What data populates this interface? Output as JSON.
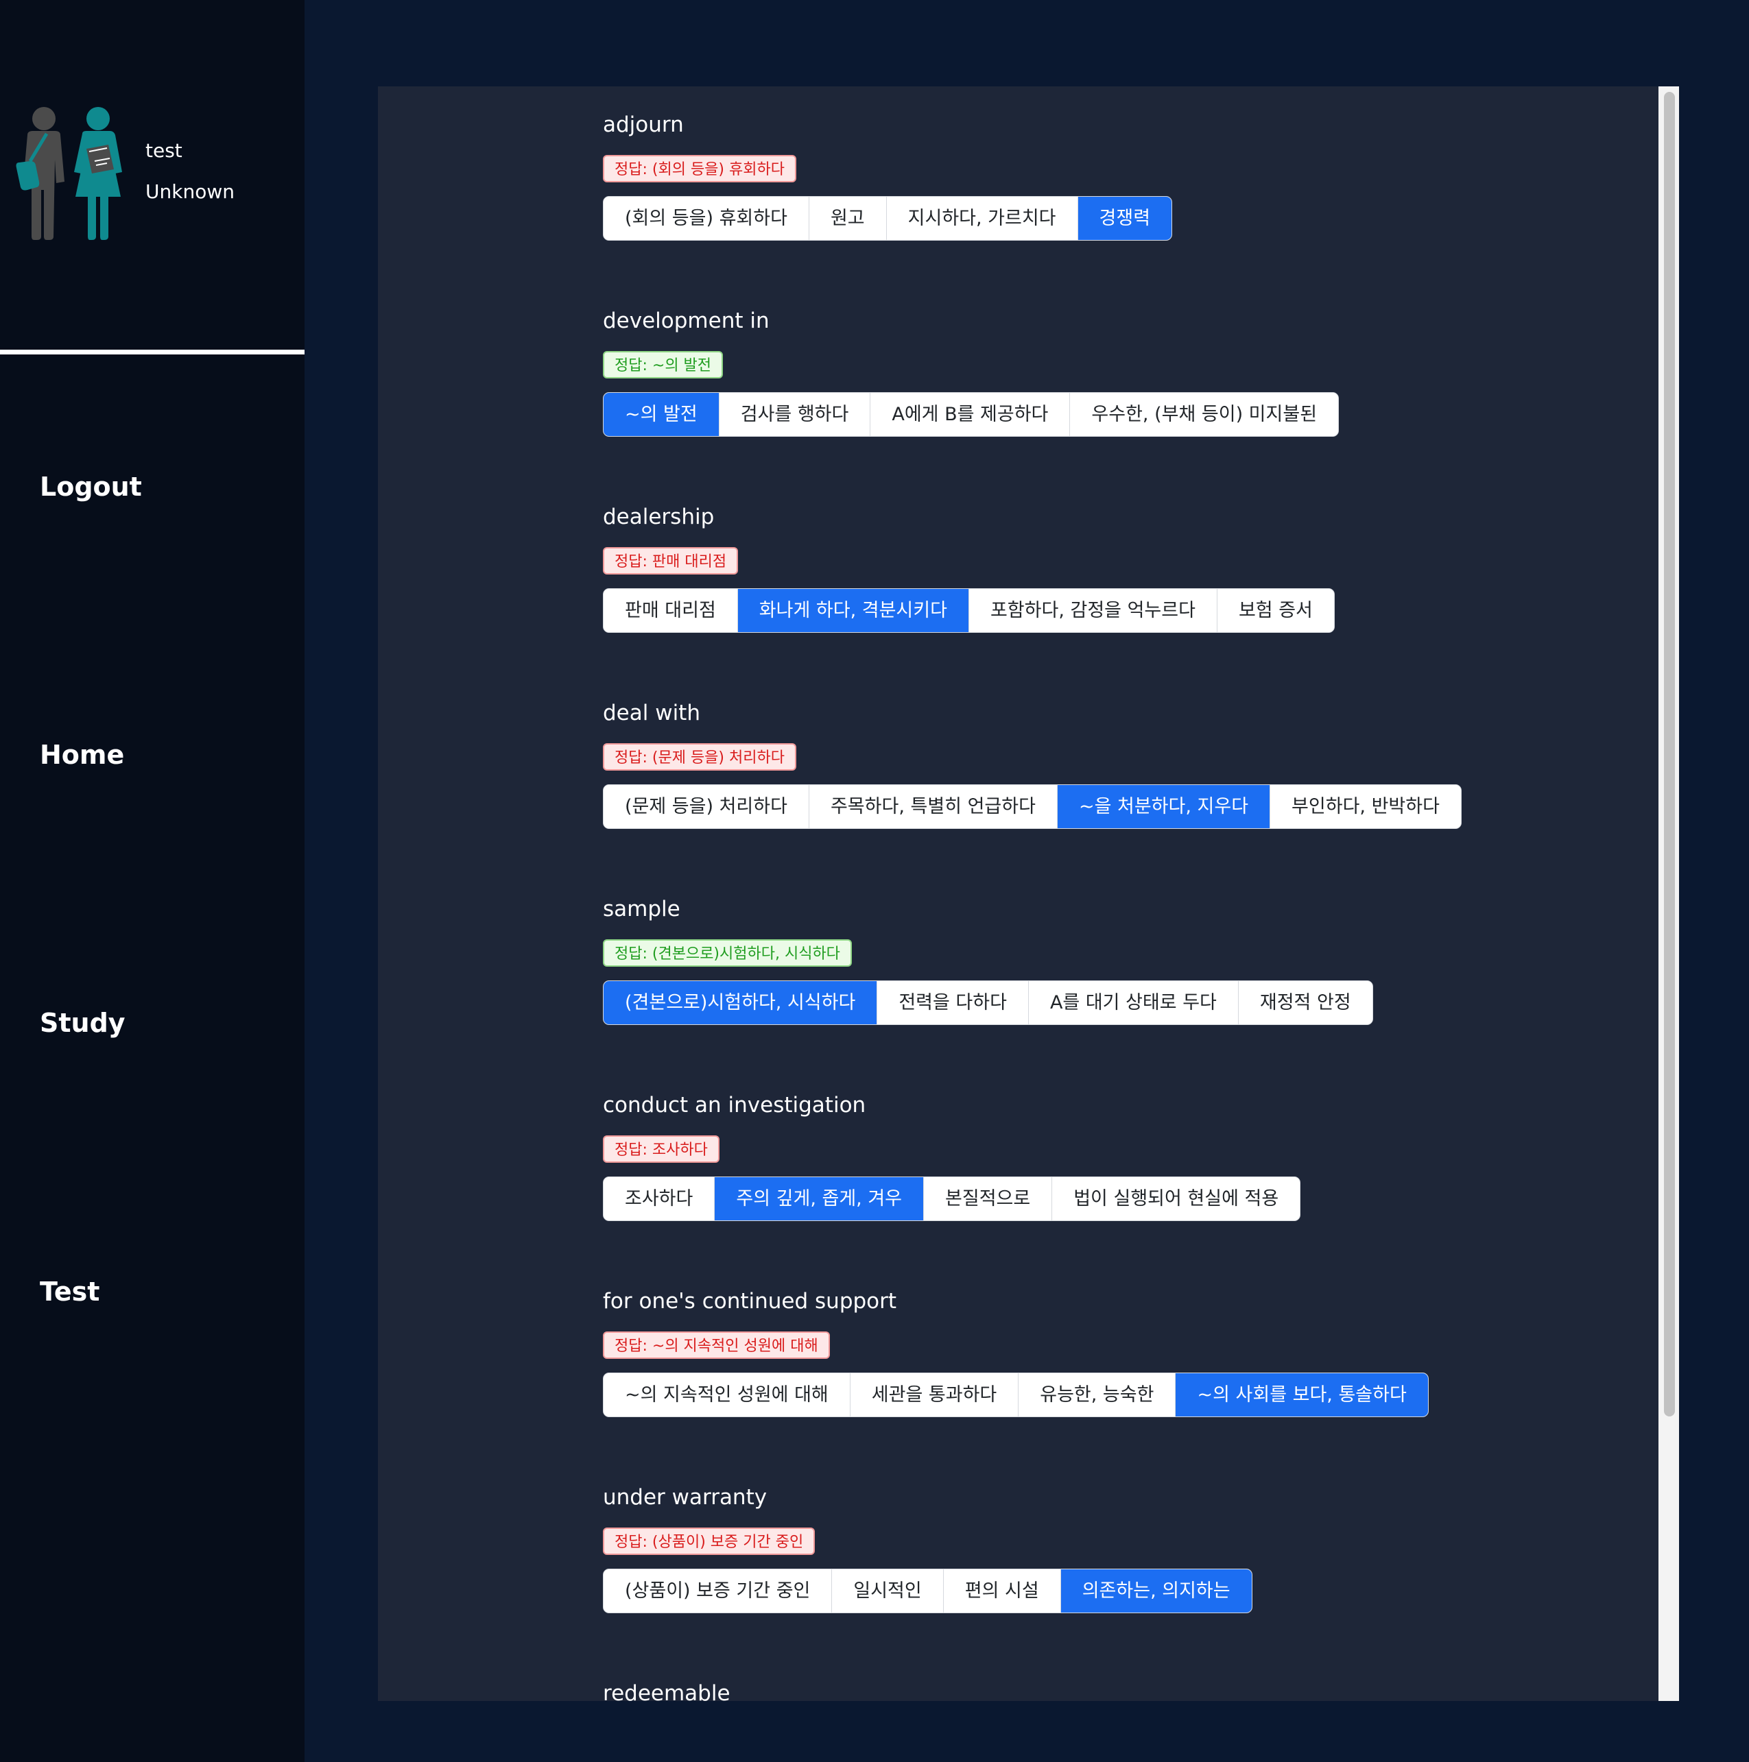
{
  "user": {
    "name": "test",
    "status": "Unknown"
  },
  "nav": {
    "logout": "Logout",
    "home": "Home",
    "study": "Study",
    "test": "Test"
  },
  "questions": [
    {
      "word": "adjourn",
      "answer": "정답: (회의 등을) 휴회하다",
      "correct": false,
      "options": [
        "(회의 등을) 휴회하다",
        "원고",
        "지시하다, 가르치다",
        "경쟁력"
      ],
      "selected_index": 3
    },
    {
      "word": "development in",
      "answer": "정답: ~의 발전",
      "correct": true,
      "options": [
        "~의 발전",
        "검사를 행하다",
        "A에게 B를 제공하다",
        "우수한, (부채 등이) 미지불된"
      ],
      "selected_index": 0
    },
    {
      "word": "dealership",
      "answer": "정답: 판매 대리점",
      "correct": false,
      "options": [
        "판매 대리점",
        "화나게 하다, 격분시키다",
        "포함하다, 감정을 억누르다",
        "보험 증서"
      ],
      "selected_index": 1
    },
    {
      "word": "deal with",
      "answer": "정답: (문제 등을) 처리하다",
      "correct": false,
      "options": [
        "(문제 등을) 처리하다",
        "주목하다, 특별히 언급하다",
        "~을 처분하다, 지우다",
        "부인하다, 반박하다"
      ],
      "selected_index": 2
    },
    {
      "word": "sample",
      "answer": "정답: (견본으로)시험하다, 시식하다",
      "correct": true,
      "options": [
        "(견본으로)시험하다, 시식하다",
        "전력을 다하다",
        "A를 대기 상태로 두다",
        "재정적 안정"
      ],
      "selected_index": 0
    },
    {
      "word": "conduct an investigation",
      "answer": "정답: 조사하다",
      "correct": false,
      "options": [
        "조사하다",
        "주의 깊게, 좁게, 겨우",
        "본질적으로",
        "법이 실행되어 현실에 적용"
      ],
      "selected_index": 1
    },
    {
      "word": "for one's continued support",
      "answer": "정답: ~의 지속적인 성원에 대해",
      "correct": false,
      "options": [
        "~의 지속적인 성원에 대해",
        "세관을 통과하다",
        "유능한, 능숙한",
        "~의 사회를 보다, 통솔하다"
      ],
      "selected_index": 3
    },
    {
      "word": "under warranty",
      "answer": "정답: (상품이) 보증 기간 중인",
      "correct": false,
      "options": [
        "(상품이) 보증 기간 중인",
        "일시적인",
        "편의 시설",
        "의존하는, 의지하는"
      ],
      "selected_index": 3
    },
    {
      "word": "redeemable",
      "answer": "",
      "correct": null,
      "options": [],
      "selected_index": null
    }
  ],
  "colors": {
    "background": "#0a1830",
    "sidebar": "#060d1a",
    "panel": "#1e2638",
    "selected_option": "#1c6ef2",
    "wrong_badge_text": "#d91c1c",
    "right_badge_text": "#1f9d1f"
  }
}
